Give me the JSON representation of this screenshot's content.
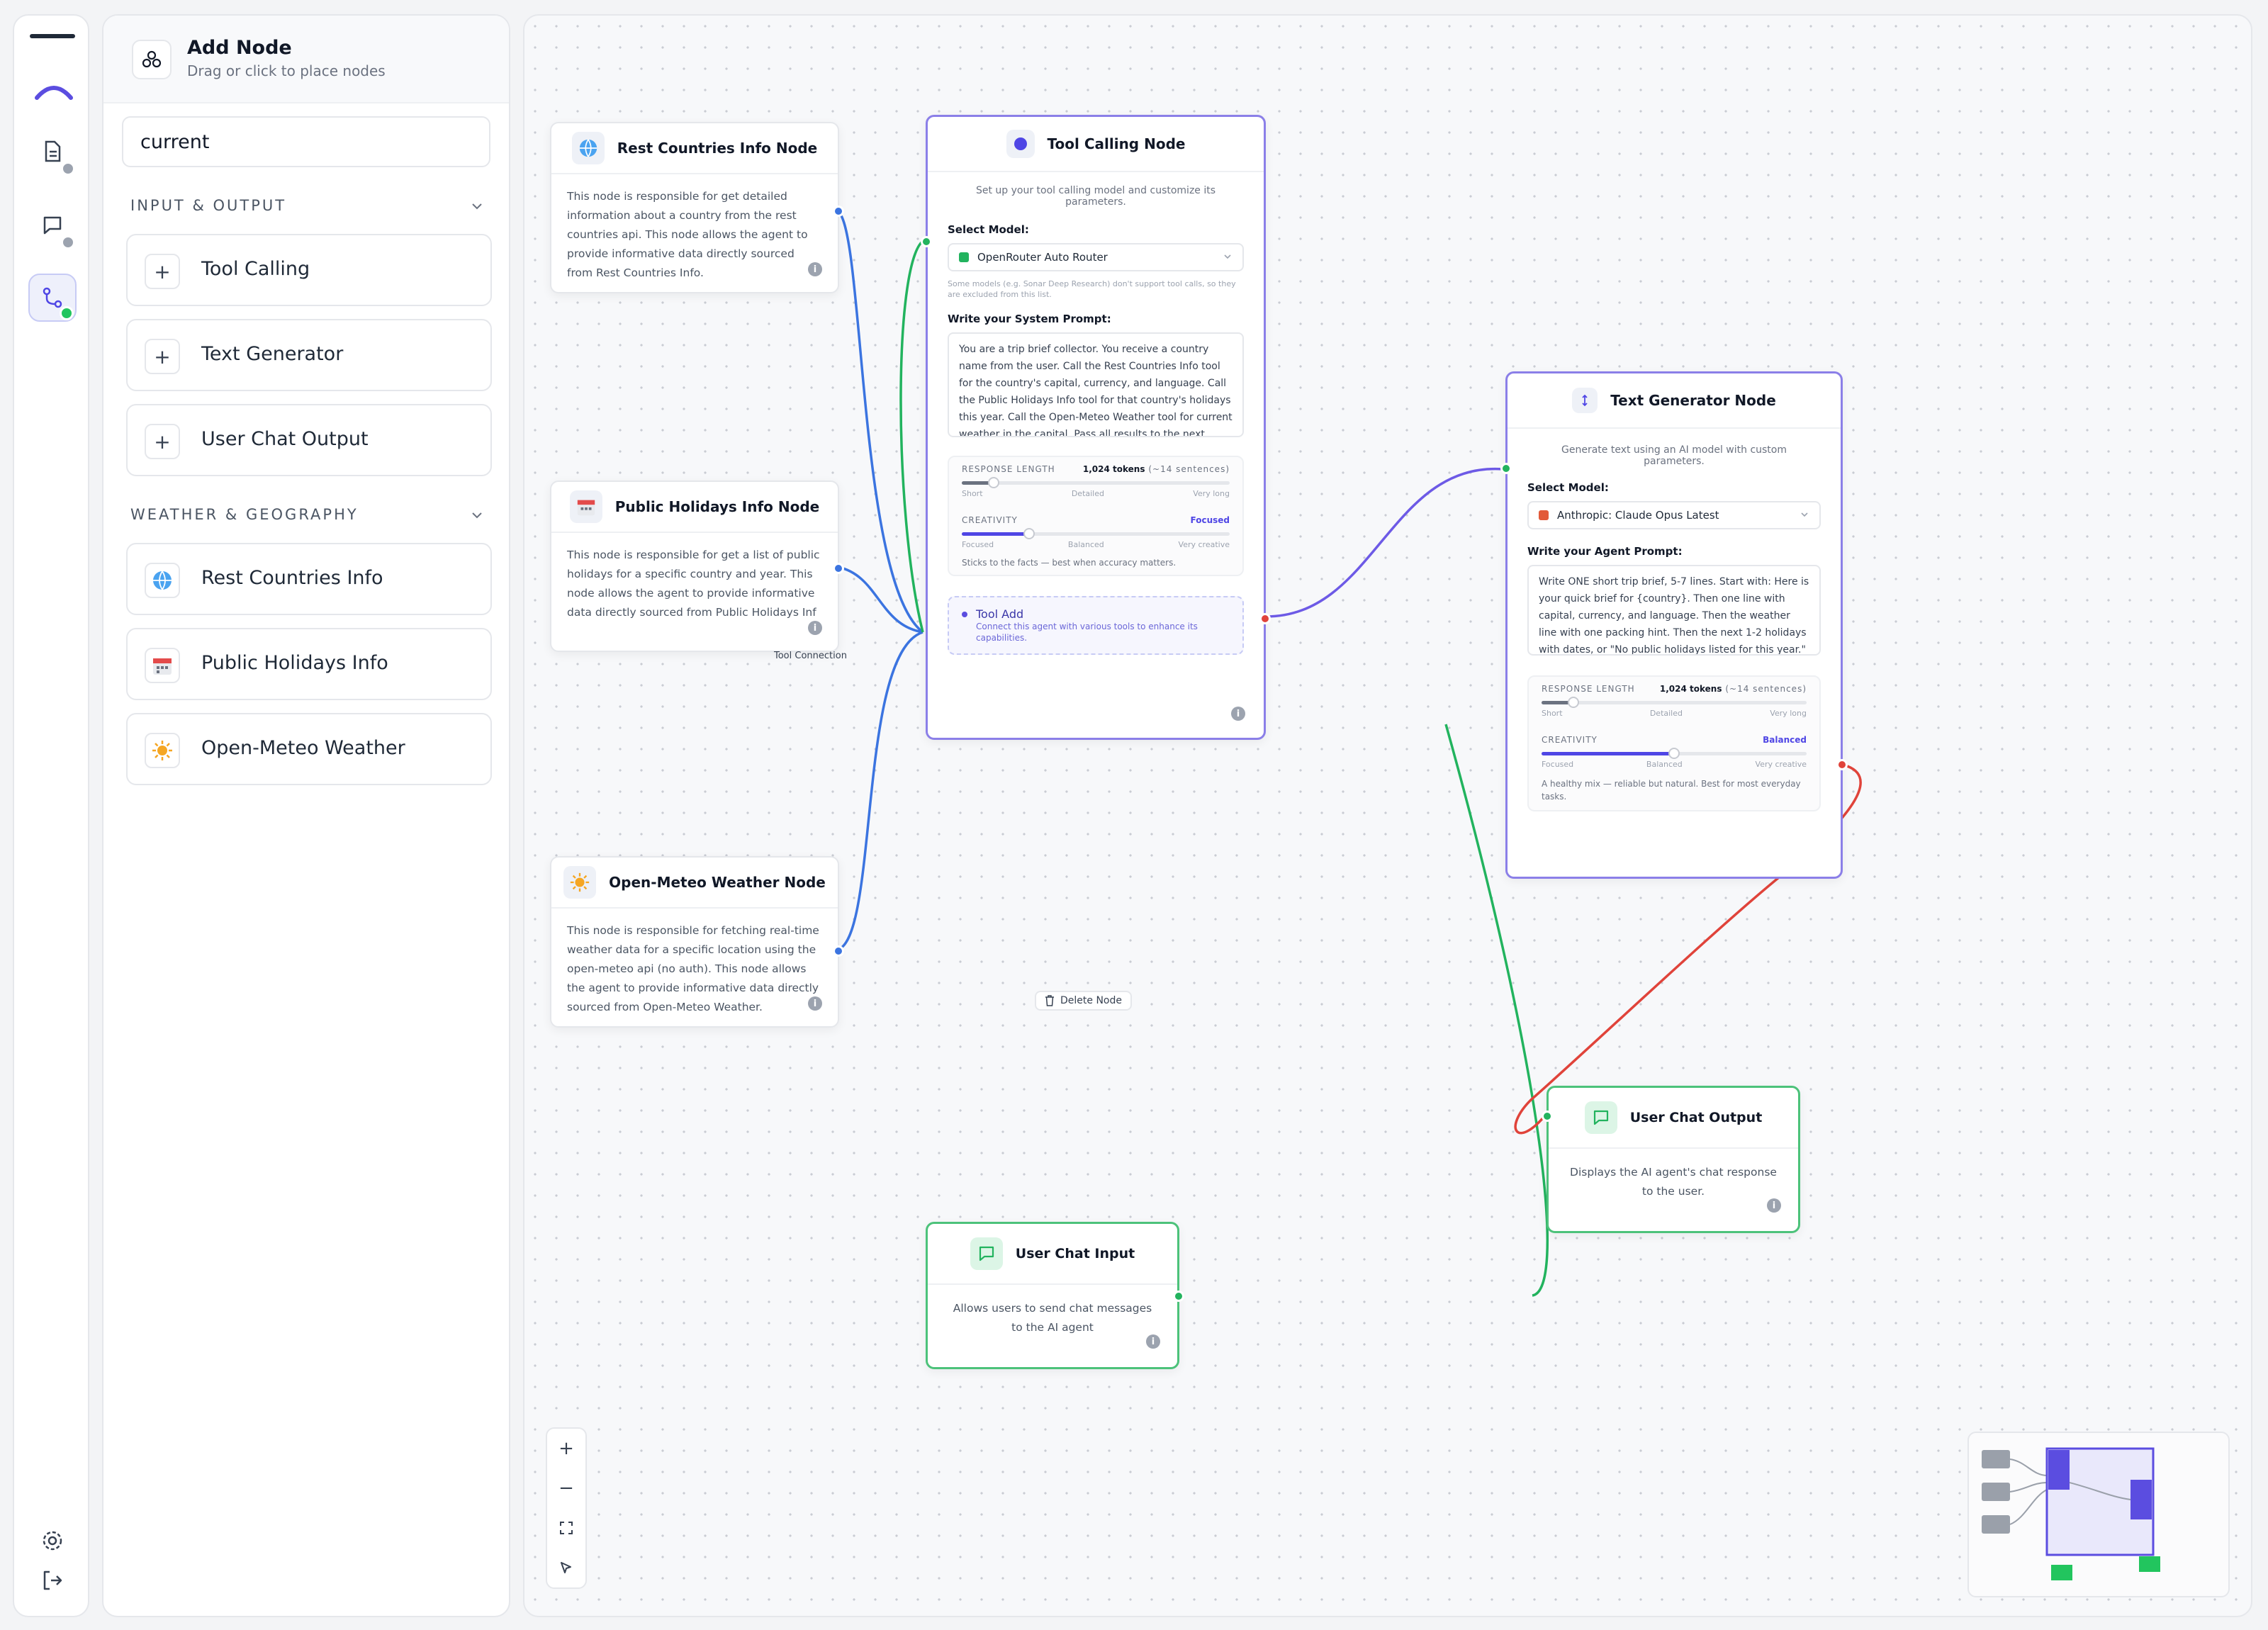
{
  "sidebar_panel": {
    "title": "Add Node",
    "subtitle": "Drag or click to place nodes",
    "search_value": "current",
    "sections": [
      {
        "label": "INPUT & OUTPUT",
        "items": [
          "Tool Calling",
          "Text Generator",
          "User Chat Output"
        ]
      },
      {
        "label": "WEATHER & GEOGRAPHY",
        "items": [
          "Rest Countries Info",
          "Public Holidays Info",
          "Open-Meteo Weather"
        ]
      }
    ]
  },
  "nodes": {
    "rest_countries": {
      "title": "Rest Countries Info Node",
      "description": "This node is responsible for get detailed information about a country from the rest countries api. This node allows the agent to provide informative data directly sourced from Rest Countries Info."
    },
    "public_holidays": {
      "title": "Public Holidays Info Node",
      "description": "This node is responsible for get a list of public holidays for a specific country and year. This node allows the agent to provide informative data directly sourced from Public Holidays Inf"
    },
    "open_meteo": {
      "title": "Open-Meteo Weather Node",
      "description": "This node is responsible for fetching real-time weather data for a specific location using the open-meteo api (no auth). This node allows the agent to provide informative data directly sourced from Open-Meteo Weather."
    },
    "tool_calling": {
      "title": "Tool Calling Node",
      "description": "Set up your tool calling model and customize its parameters.",
      "select_model_label": "Select Model:",
      "model": "OpenRouter Auto Router",
      "model_note": "Some models (e.g. Sonar Deep Research) don't support tool calls, so they are excluded from this list.",
      "prompt_label": "Write your System Prompt:",
      "prompt": "You are a trip brief collector. You receive a country name from the user. Call the Rest Countries Info tool for the country's capital, currency, and language. Call the Public Holidays Info tool for that country's holidays this year. Call the Open-Meteo Weather tool for current weather in the capital. Pass all results to the next node.",
      "response_length_label": "RESPONSE LENGTH",
      "response_length_value": "1,024 tokens",
      "response_length_hint": "(~14 sentences)",
      "length_ticks": [
        "Short",
        "Detailed",
        "Very long"
      ],
      "length_level": 0.12,
      "creativity_label": "CREATIVITY",
      "creativity_value": "Focused",
      "creativity_ticks": [
        "Focused",
        "Balanced",
        "Very creative"
      ],
      "creativity_level": 0.25,
      "creativity_desc": "Sticks to the facts — best when accuracy matters.",
      "tool_add_title": "Tool Add",
      "tool_add_desc": "Connect this agent with various tools to enhance its capabilities."
    },
    "text_generator": {
      "title": "Text Generator Node",
      "description": "Generate text using an AI model with custom parameters.",
      "select_model_label": "Select Model:",
      "model": "Anthropic: Claude Opus Latest",
      "prompt_label": "Write your Agent Prompt:",
      "prompt": "Write ONE short trip brief, 5-7 lines. Start with: Here is your quick brief for {country}. Then one line with capital, currency, and language. Then the weather line with one packing hint. Then the next 1-2 holidays with dates, or \"No public holidays listed for this year.\" End with one",
      "response_length_label": "RESPONSE LENGTH",
      "response_length_value": "1,024 tokens",
      "response_length_hint": "(~14 sentences)",
      "length_ticks": [
        "Short",
        "Detailed",
        "Very long"
      ],
      "length_level": 0.12,
      "creativity_label": "CREATIVITY",
      "creativity_value": "Balanced",
      "creativity_ticks": [
        "Focused",
        "Balanced",
        "Very creative"
      ],
      "creativity_level": 0.5,
      "creativity_desc": "A healthy mix — reliable but natural. Best for most everyday tasks."
    },
    "user_chat_output": {
      "title": "User Chat Output",
      "description": "Displays the AI agent's chat response to the user."
    },
    "user_chat_input": {
      "title": "User Chat Input",
      "description": "Allows users to send chat messages to the AI agent"
    }
  },
  "canvas": {
    "tool_connection_label": "Tool Connection",
    "delete_node_label": "Delete Node"
  },
  "colors": {
    "accent": "#5b4de0",
    "wire_blue": "#3b74e0",
    "wire_green": "#22b35e",
    "wire_purple": "#6d5ae6",
    "wire_red": "#e0433a"
  }
}
